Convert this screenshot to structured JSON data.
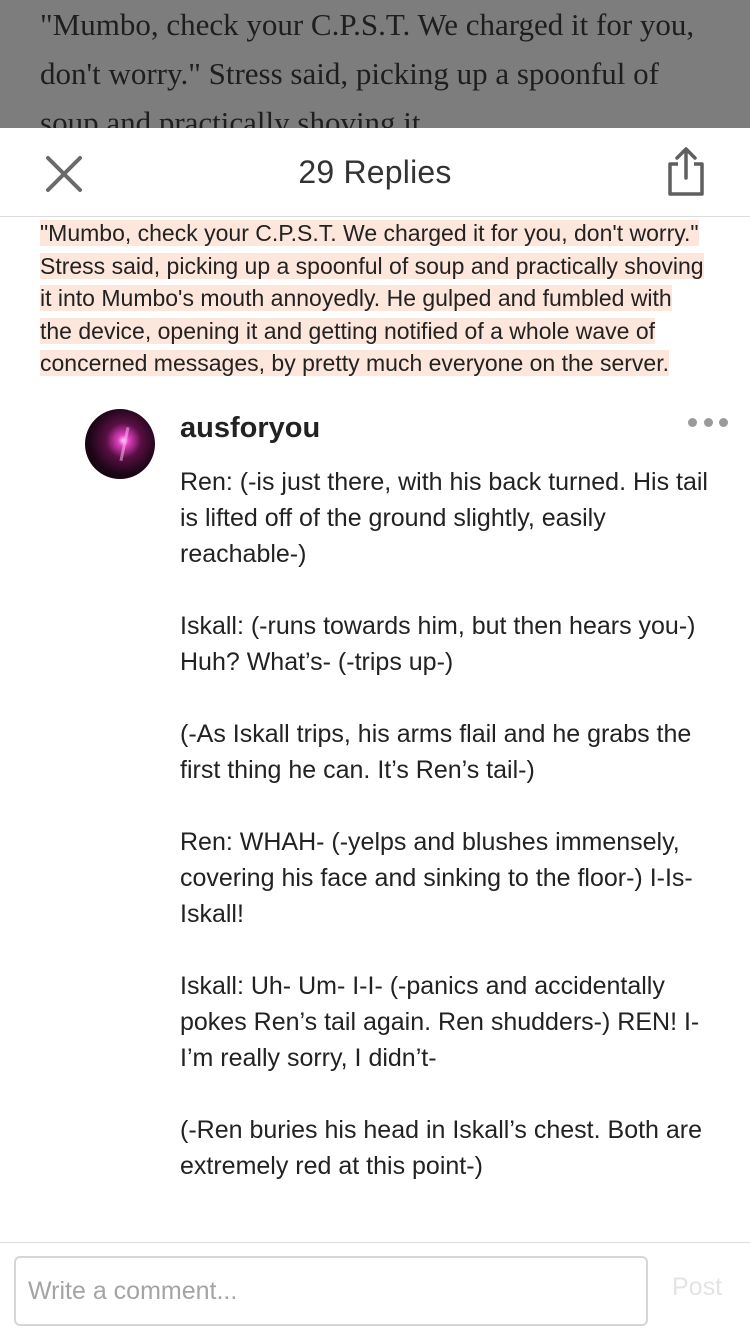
{
  "story": {
    "background_text": "\"Mumbo, check your C.P.S.T. We charged it for you, don't worry.\" Stress said, picking up a spoonful of soup and practically shoving it"
  },
  "header": {
    "title": "29 Replies",
    "close_icon": "close-icon",
    "share_icon": "share-icon"
  },
  "highlight": {
    "text": "\"Mumbo, check your C.P.S.T. We charged it for you, don't worry.\" Stress said, picking up a spoonful of soup and practically shoving it into Mumbo's mouth annoyedly. He gulped and fumbled with the device, opening it and getting notified of a whole wave of concerned messages, by pretty much everyone on the server.",
    "color": "#fde6dc"
  },
  "comment": {
    "username": "ausforyou",
    "more_icon": "more-horizontal-icon",
    "paragraphs": [
      "Ren: (-is just there, with his back turned. His tail is lifted off of the ground slightly, easily reachable-)",
      "Iskall: (-runs towards him, but then hears you-) Huh? What’s- (-trips up-)",
      "(-As Iskall trips, his arms flail and he grabs the first thing he can. It’s Ren’s tail-)",
      "Ren: WHAH- (-yelps and blushes immensely, covering his face and sinking to the floor-) I-Is-Iskall!",
      "Iskall: Uh- Um- I-I- (-panics and accidentally pokes Ren’s tail again. Ren shudders-) REN! I-I’m really sorry, I didn’t-",
      "(-Ren buries his head in Iskall’s chest. Both are extremely red at this point-)"
    ]
  },
  "composer": {
    "placeholder": "Write a comment...",
    "value": "",
    "post_label": "Post"
  }
}
